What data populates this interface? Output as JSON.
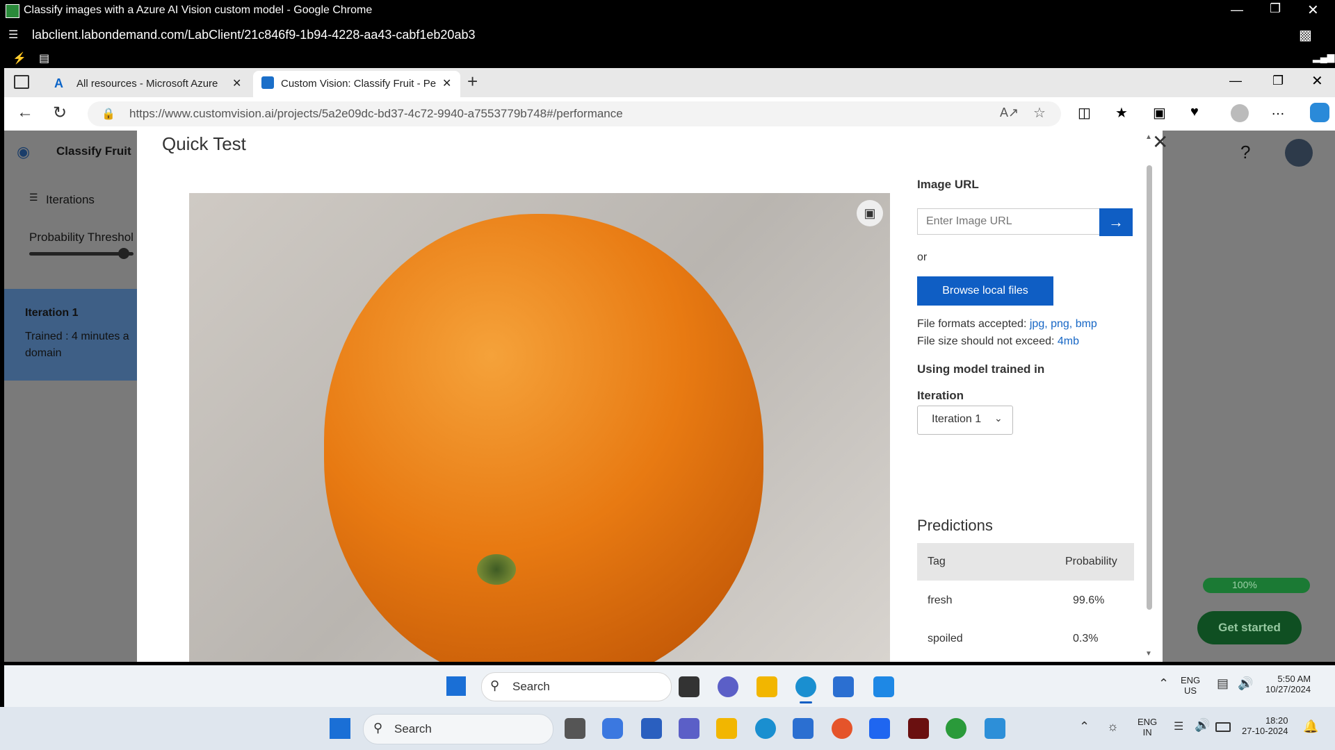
{
  "outer_window": {
    "title": "Classify images with a Azure AI Vision custom model - Google Chrome",
    "address": "labclient.labondemand.com/LabClient/21c846f9-1b94-4228-aa43-cabf1eb20ab3"
  },
  "inner_browser": {
    "tabs": [
      {
        "label": "All resources - Microsoft Azure"
      },
      {
        "label": "Custom Vision: Classify Fruit - Pe"
      }
    ],
    "url": "https://www.customvision.ai/projects/5a2e09dc-bd37-4c72-9940-a7553779b748#/performance"
  },
  "page": {
    "project_name": "Classify Fruit",
    "nav_iterations": "Iterations",
    "probability_threshold": "Probability Threshol",
    "iteration_title": "Iteration 1",
    "iteration_trained": "Trained : 4 minutes a",
    "iteration_domain": "domain",
    "help": "?",
    "progress_label": "100%",
    "progress_value": 1.0,
    "get_started": "Get started"
  },
  "modal": {
    "title": "Quick Test",
    "image_url_label": "Image URL",
    "image_url_placeholder": "Enter Image URL",
    "or": "or",
    "browse_button": "Browse local files",
    "formats_prefix": "File formats accepted:",
    "formats": "jpg, png, bmp",
    "size_prefix": "File size should not exceed:",
    "size": "4mb",
    "using_model": "Using model trained in",
    "iteration_label": "Iteration",
    "iteration_selected": "Iteration 1",
    "predictions_title": "Predictions",
    "table_headers": {
      "tag": "Tag",
      "probability": "Probability"
    },
    "predictions": [
      {
        "tag": "fresh",
        "probability": "99.6%"
      },
      {
        "tag": "spoiled",
        "probability": "0.3%"
      }
    ]
  },
  "remote_taskbar": {
    "search": "Search",
    "lang_1": "ENG",
    "lang_2": "US",
    "time": "5:50 AM",
    "date": "10/27/2024"
  },
  "local_taskbar": {
    "search": "Search",
    "lang_1": "ENG",
    "lang_2": "IN",
    "time": "18:20",
    "date": "27-10-2024"
  },
  "colors": {
    "accent_blue": "#0f5ec4",
    "link_blue": "#1666c5",
    "progress_green": "#1b7a34",
    "orange": "#e87a12"
  }
}
